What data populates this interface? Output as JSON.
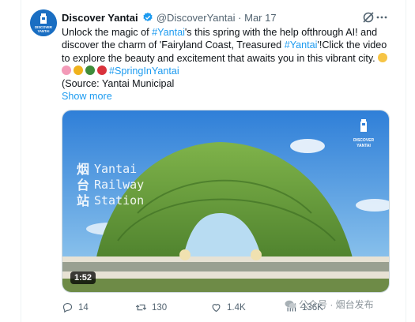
{
  "tweet": {
    "account_name": "Discover Yantai",
    "handle": "@DiscoverYantai",
    "separator": "·",
    "date": "Mar 17",
    "avatar_label": {
      "line1": "DISCOVER",
      "line2": "YANTAI"
    },
    "body": {
      "p1_a": "Unlock the magic of ",
      "p1_tag1": "#Yantai",
      "p1_b": "'s this spring with the help ofthrough AI! and discover the charm of 'Fairyland Coast, Treasured ",
      "p1_tag2": "#Yantai",
      "p1_c": "'!Click the video to explore the beauty and excitement that awaits you in this vibrant city.",
      "p2_tag": "#SpringInYantai",
      "p3": "(Source: Yantai Municipal",
      "show_more": "Show more"
    },
    "video": {
      "overlay_cn": "烟台站",
      "overlay_en_1": "Yantai",
      "overlay_en_2": "Railway",
      "overlay_en_3": "Station",
      "logo_text_1": "DISCOVER",
      "logo_text_2": "YANTAI",
      "duration": "1:52"
    },
    "actions": {
      "replies": "14",
      "reposts": "130",
      "likes": "1.4K",
      "views": "136K"
    }
  },
  "watermark": "公众号 · 烟台发布",
  "colors": {
    "link": "#1d9bf0",
    "text": "#0f1419",
    "secondary": "#536471",
    "verified": "#1d9bf0",
    "avatar_bg": "#1a6ec2"
  },
  "icons": [
    "verified-badge-icon",
    "grok-icon",
    "more-options-icon",
    "reply-icon",
    "repost-icon",
    "like-icon",
    "views-icon",
    "wechat-icon"
  ]
}
